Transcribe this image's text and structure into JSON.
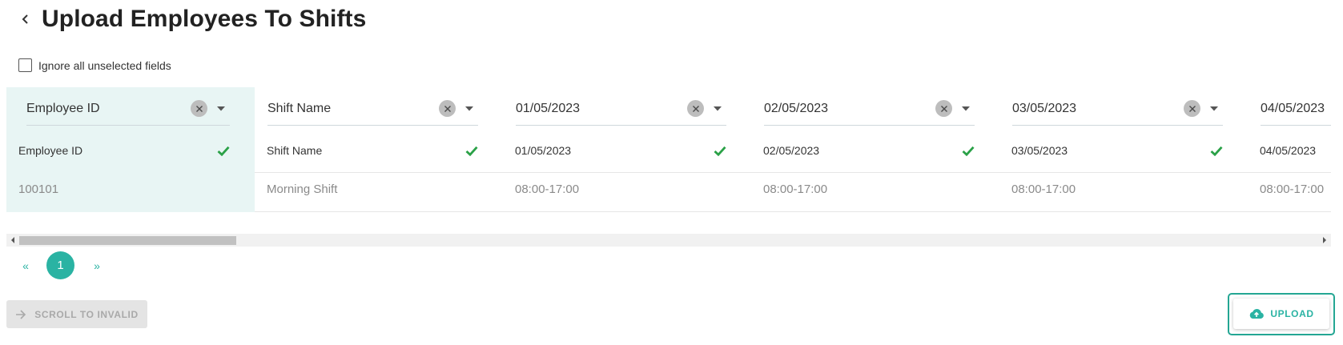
{
  "page": {
    "title": "Upload Employees To Shifts",
    "ignore_label": "Ignore all unselected fields"
  },
  "columns": [
    {
      "mapping": "Employee ID",
      "header": "Employee ID",
      "value": "100101",
      "selected": true
    },
    {
      "mapping": "Shift Name",
      "header": "Shift Name",
      "value": "Morning Shift",
      "selected": false
    },
    {
      "mapping": "01/05/2023",
      "header": "01/05/2023",
      "value": "08:00-17:00",
      "selected": false
    },
    {
      "mapping": "02/05/2023",
      "header": "02/05/2023",
      "value": "08:00-17:00",
      "selected": false
    },
    {
      "mapping": "03/05/2023",
      "header": "03/05/2023",
      "value": "08:00-17:00",
      "selected": false
    },
    {
      "mapping": "04/05/2023",
      "header": "04/05/2023",
      "value": "08:00-17:00",
      "selected": false
    }
  ],
  "pagination": {
    "prev": "«",
    "current": "1",
    "next": "»"
  },
  "actions": {
    "scroll_to_invalid": "SCROLL TO INVALID",
    "upload": "UPLOAD"
  },
  "colors": {
    "accent": "#2ab3a3",
    "valid_check": "#2aa147",
    "selected_column_bg": "#e8f5f4"
  }
}
